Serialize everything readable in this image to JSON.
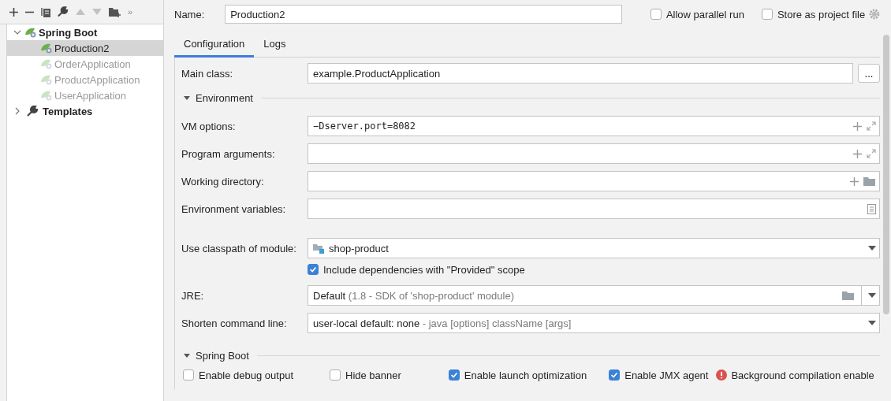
{
  "toolbar": {
    "overflow": "»"
  },
  "tree": [
    {
      "label": "Spring Boot",
      "expanded": true,
      "children": [
        {
          "label": "Production2",
          "selected": true,
          "disabled": false
        },
        {
          "label": "OrderApplication",
          "selected": false,
          "disabled": true
        },
        {
          "label": "ProductApplication",
          "selected": false,
          "disabled": true
        },
        {
          "label": "UserApplication",
          "selected": false,
          "disabled": true
        }
      ]
    },
    {
      "label": "Templates",
      "expanded": false
    }
  ],
  "name": {
    "label": "Name:",
    "value": "Production2"
  },
  "options": [
    {
      "label": "Allow parallel run",
      "checked": false
    },
    {
      "label": "Store as project file",
      "checked": false
    }
  ],
  "tabs": [
    {
      "label": "Configuration",
      "selected": true
    },
    {
      "label": "Logs",
      "selected": false
    }
  ],
  "rows": [
    {
      "kind": "browse",
      "label": "Main class:",
      "value": "example.ProductApplication",
      "button": "..."
    },
    {
      "kind": "section",
      "label": "Environment",
      "expanded": true
    },
    {
      "kind": "args",
      "label": "VM options:",
      "value": "−Dserver.port=8082"
    },
    {
      "kind": "args",
      "label": "Program arguments:",
      "value": ""
    },
    {
      "kind": "path",
      "label": "Working directory:",
      "value": ""
    },
    {
      "kind": "env",
      "label": "Environment variables:",
      "value": ""
    },
    {
      "kind": "module",
      "label": "Use classpath of module:",
      "value": "shop-product"
    },
    {
      "kind": "checkbox",
      "label": "Include dependencies with \"Provided\" scope",
      "checked": true
    },
    {
      "kind": "jre",
      "label": "JRE:",
      "value": "Default",
      "hint": "(1.8 - SDK of 'shop-product' module)"
    },
    {
      "kind": "dropdown",
      "label": "Shorten command line:",
      "value": "user-local default: none",
      "hint": "- java [options] className [args]"
    },
    {
      "kind": "section",
      "label": "Spring Boot",
      "expanded": true
    },
    {
      "kind": "checks",
      "items": [
        {
          "label": "Enable debug output",
          "checked": false
        },
        {
          "label": "Hide banner",
          "checked": false
        },
        {
          "label": "Enable launch optimization",
          "checked": true
        },
        {
          "label": "Enable JMX agent",
          "checked": true
        }
      ],
      "warning": "Background compilation enable"
    }
  ]
}
